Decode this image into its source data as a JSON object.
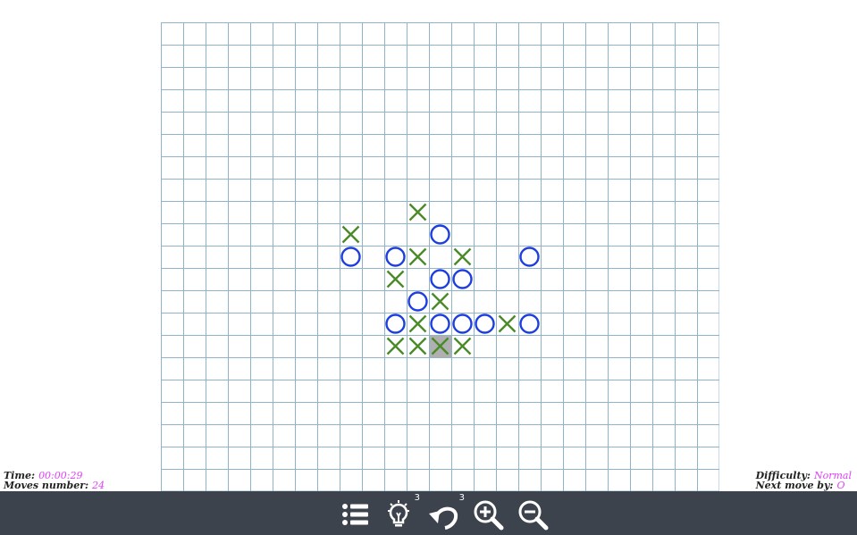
{
  "board": {
    "cols": 25,
    "rows": 21,
    "grid_color": "#8fb4c9",
    "x_color": "#4a8a2a",
    "o_color": "#1f3ee0",
    "highlight_color": "#b0b0b0",
    "pieces": [
      {
        "col": 11,
        "row": 8,
        "type": "X"
      },
      {
        "col": 12,
        "row": 9,
        "type": "O"
      },
      {
        "col": 8,
        "row": 9,
        "type": "X"
      },
      {
        "col": 8,
        "row": 10,
        "type": "O"
      },
      {
        "col": 10,
        "row": 10,
        "type": "O"
      },
      {
        "col": 11,
        "row": 10,
        "type": "X"
      },
      {
        "col": 13,
        "row": 10,
        "type": "X"
      },
      {
        "col": 16,
        "row": 10,
        "type": "O"
      },
      {
        "col": 10,
        "row": 11,
        "type": "X"
      },
      {
        "col": 12,
        "row": 11,
        "type": "O"
      },
      {
        "col": 13,
        "row": 11,
        "type": "O"
      },
      {
        "col": 11,
        "row": 12,
        "type": "O"
      },
      {
        "col": 12,
        "row": 12,
        "type": "X"
      },
      {
        "col": 10,
        "row": 13,
        "type": "O"
      },
      {
        "col": 11,
        "row": 13,
        "type": "X"
      },
      {
        "col": 12,
        "row": 13,
        "type": "O"
      },
      {
        "col": 13,
        "row": 13,
        "type": "O"
      },
      {
        "col": 14,
        "row": 13,
        "type": "O"
      },
      {
        "col": 15,
        "row": 13,
        "type": "X"
      },
      {
        "col": 16,
        "row": 13,
        "type": "O"
      },
      {
        "col": 10,
        "row": 14,
        "type": "X"
      },
      {
        "col": 11,
        "row": 14,
        "type": "X"
      },
      {
        "col": 12,
        "row": 14,
        "type": "X",
        "last": true
      },
      {
        "col": 13,
        "row": 14,
        "type": "X"
      }
    ]
  },
  "stats": {
    "time_label": "Time:",
    "time_value": "00:00:29",
    "moves_label": "Moves number:",
    "moves_value": "24",
    "difficulty_label": "Difficulty:",
    "difficulty_value": "Normal",
    "next_label": "Next move by:",
    "next_value": "O"
  },
  "toolbar": {
    "hint_count": "3",
    "undo_count": "3",
    "bg_color": "#3d434c",
    "icon_color": "#ffffff"
  }
}
